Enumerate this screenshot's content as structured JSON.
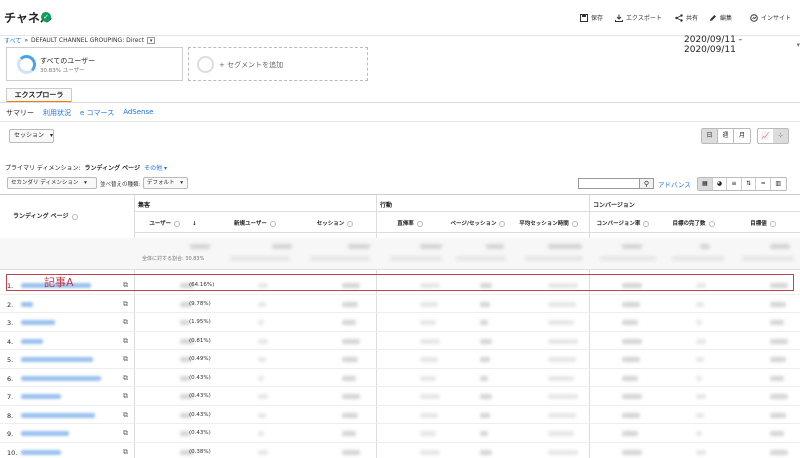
{
  "header": {
    "title": "チャネル",
    "actions": [
      {
        "label": "保存",
        "icon": "save-icon"
      },
      {
        "label": "エクスポート",
        "icon": "export-icon"
      },
      {
        "label": "共有",
        "icon": "share-icon"
      },
      {
        "label": "編集",
        "icon": "edit-icon"
      },
      {
        "label": "インサイト",
        "icon": "insights-icon"
      }
    ]
  },
  "breadcrumb": {
    "root": "すべて",
    "separator": "»",
    "current": "DEFAULT CHANNEL GROUPING: Direct"
  },
  "date_range": "2020/09/11 - 2020/09/11",
  "segment": {
    "name": "すべてのユーザー",
    "percent": "30.83% ユーザー",
    "add_label": "+ セグメントを追加"
  },
  "explorer_tab": "エクスプローラ",
  "subtabs": [
    "サマリー",
    "利用状況",
    "e コマース",
    "AdSense"
  ],
  "metric_select": "セッション",
  "periods": [
    "日",
    "週",
    "月"
  ],
  "primary_dimension": {
    "label": "プライマリ ディメンション:",
    "current": "ランディング ページ",
    "other": "その他"
  },
  "secondary_select": "セカンダリ ディメンション",
  "sort_label": "並べ替えの種類:",
  "sort_select": "デフォルト",
  "advanced_label": "アドバンス",
  "table": {
    "groups": {
      "acquisition": "集客",
      "behavior": "行動",
      "conversion": "コンバージョン"
    },
    "landing_header": "ランディング ページ",
    "columns": [
      "ユーザー",
      "新規ユーザー",
      "セッション",
      "直帰率",
      "ページ/セッション",
      "平均セッション時間",
      "コンバージョン率",
      "目標の完了数",
      "目標値"
    ],
    "total_share": "全体に対する割合: 30.83%",
    "rows": [
      {
        "rank": "1.",
        "pct": "(64.16%)"
      },
      {
        "rank": "2.",
        "pct": "(9.78%)"
      },
      {
        "rank": "3.",
        "pct": "(1.95%)"
      },
      {
        "rank": "4.",
        "pct": "(0.81%)"
      },
      {
        "rank": "5.",
        "pct": "(0.49%)"
      },
      {
        "rank": "6.",
        "pct": "(0.43%)"
      },
      {
        "rank": "7.",
        "pct": "(0.43%)"
      },
      {
        "rank": "8.",
        "pct": "(0.43%)"
      },
      {
        "rank": "9.",
        "pct": "(0.43%)"
      },
      {
        "rank": "10.",
        "pct": "(0.38%)"
      }
    ]
  },
  "annotation": "記事A"
}
